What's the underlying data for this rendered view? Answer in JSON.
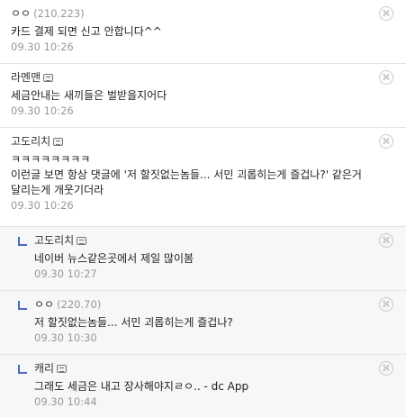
{
  "comments": [
    {
      "nick": "ㅇㅇ",
      "ip": "(210.223)",
      "text": "카드 결제 되면 신고 안합니다^^",
      "date": "09.30 10:26"
    },
    {
      "nick": "라멘맨",
      "text": "세금안내는 새끼들은 벌받을지어다",
      "date": "09.30 10:26"
    },
    {
      "nick": "고도리치",
      "text": "ㅋㅋㅋㅋㅋㅋㅋㅋ\n이런글 보면 항상 댓글에 '저 할짓없는놈들... 서민 괴롭히는게 즐겁나?' 같은거\n달리는게 개웃기더라",
      "date": "09.30 10:26"
    },
    {
      "nick": "고도리치",
      "text": "네이버 뉴스같은곳에서 제일 많이봄",
      "date": "09.30 10:27"
    },
    {
      "nick": "ㅇㅇ",
      "ip": "(220.70)",
      "text": "저 할짓없는놈들... 서민 괴롭히는게 즐겁나?",
      "date": "09.30 10:30"
    },
    {
      "nick": "캐리",
      "text": "그래도 세금은 내고 장사해야지ㄹㅇ.. - dc App",
      "date": "09.30 10:44"
    }
  ],
  "icons": {
    "delete": "close-circle-icon",
    "user_badge": "fixed-nick-icon",
    "reply": "reply-arrow-icon"
  },
  "colors": {
    "reply_bg": "#f7f7f9",
    "reply_arrow": "#4b6ab5",
    "date": "#999999"
  }
}
